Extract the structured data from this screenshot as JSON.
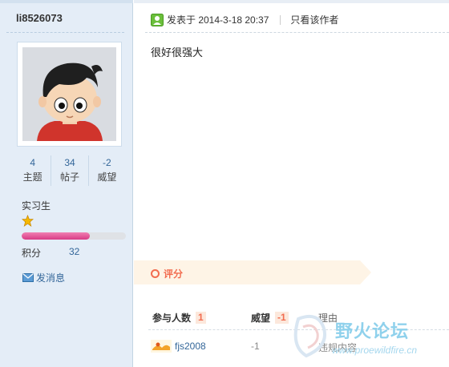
{
  "user": {
    "name": "li8526073",
    "stats": [
      {
        "value": "4",
        "label": "主题"
      },
      {
        "value": "34",
        "label": "帖子"
      },
      {
        "value": "-2",
        "label": "威望"
      }
    ],
    "rank": "实习生",
    "rank_star_color": "#f5b800",
    "progress_fraction": 0.65,
    "points_label": "积分",
    "points_value": "32",
    "message_label": "发消息"
  },
  "post": {
    "time_text": "发表于 2014-3-18 20:37",
    "only_author": "只看该作者",
    "body": "很好很强大"
  },
  "rating": {
    "title": "评分",
    "col_people": "参与人数",
    "people_count": "1",
    "col_prestige": "威望",
    "prestige_total": "-1",
    "col_reason": "理由",
    "rows": [
      {
        "user": "fjs2008",
        "value": "-1",
        "reason": "违规内容"
      }
    ]
  },
  "watermark": {
    "title": "野火论坛",
    "url": "www.proewildfire.cn"
  },
  "colors": {
    "link": "#336699",
    "accent": "#f26c4f",
    "side_bg": "#e4edf7"
  }
}
